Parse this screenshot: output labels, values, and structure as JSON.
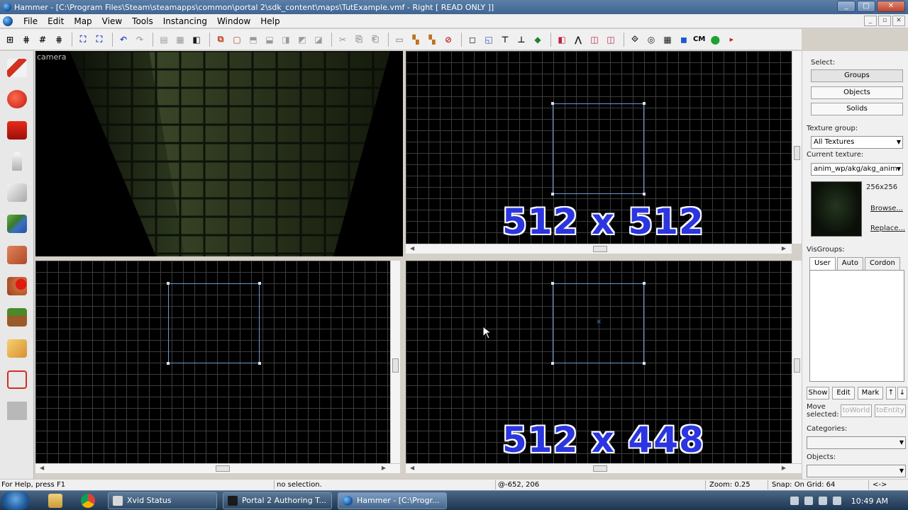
{
  "window": {
    "title": "Hammer - [C:\\Program Files\\Steam\\steamapps\\common\\portal 2\\sdk_content\\maps\\TutExample.vmf - Right [ READ ONLY ]]",
    "minimize": "_",
    "maximize": "□",
    "close": "✕"
  },
  "menu": [
    "File",
    "Edit",
    "Map",
    "View",
    "Tools",
    "Instancing",
    "Window",
    "Help"
  ],
  "mdi_controls": [
    "_",
    "▫",
    "✕"
  ],
  "toolbar": {
    "buttons": [
      "⊞",
      "⋕",
      "#",
      "⋕",
      "⛶",
      "⛶",
      "↶",
      "↷",
      "▤",
      "▦",
      "◧",
      "⧉",
      "▢",
      "⬒",
      "⬓",
      "◨",
      "◩",
      "◪",
      "✂",
      "⎘",
      "⎗",
      "▭",
      "▚",
      "▚",
      "⊘",
      "◻",
      "◱",
      "⊤",
      "⊥",
      "◆",
      "◧",
      "⋀",
      "◫",
      "◫",
      "⟐",
      "◎",
      "▦",
      "◼",
      "⬤"
    ],
    "cm_label": "CM"
  },
  "viewports": {
    "camera_label": "camera",
    "top_right_overlay": "512 x 512",
    "bottom_right_overlay": "512 x 448"
  },
  "right_panel": {
    "select_label": "Select:",
    "select_buttons": [
      "Groups",
      "Objects",
      "Solids"
    ],
    "texture_group_label": "Texture group:",
    "texture_group_value": "All Textures",
    "current_texture_label": "Current texture:",
    "current_texture_value": "anim_wp/akg/akg_anim",
    "texture_size": "256x256",
    "browse": "Browse...",
    "replace": "Replace...",
    "visgroups_label": "VisGroups:",
    "vis_tabs": [
      "User",
      "Auto",
      "Cordon"
    ],
    "show": "Show",
    "edit": "Edit",
    "mark": "Mark",
    "up": "↑",
    "down": "↓",
    "move_selected": "Move selected:",
    "to_world": "toWorld",
    "to_entity": "toEntity",
    "categories_label": "Categories:",
    "objects_label": "Objects:"
  },
  "status": {
    "help": "For Help, press F1",
    "selection": "no selection.",
    "coords": "@-652, 206",
    "zoom": "Zoom: 0.25",
    "snap": "Snap: On Grid: 64",
    "extra": "<->"
  },
  "taskbar": {
    "tasks": [
      "Xvid Status",
      "Portal 2 Authoring T...",
      "Hammer - [C:\\Progr..."
    ],
    "clock": "10:49 AM"
  },
  "colors": {
    "overlay_text": "#2b35e0",
    "brush_outline": "#6a9bd0",
    "grid_line": "#3c3c3c"
  }
}
